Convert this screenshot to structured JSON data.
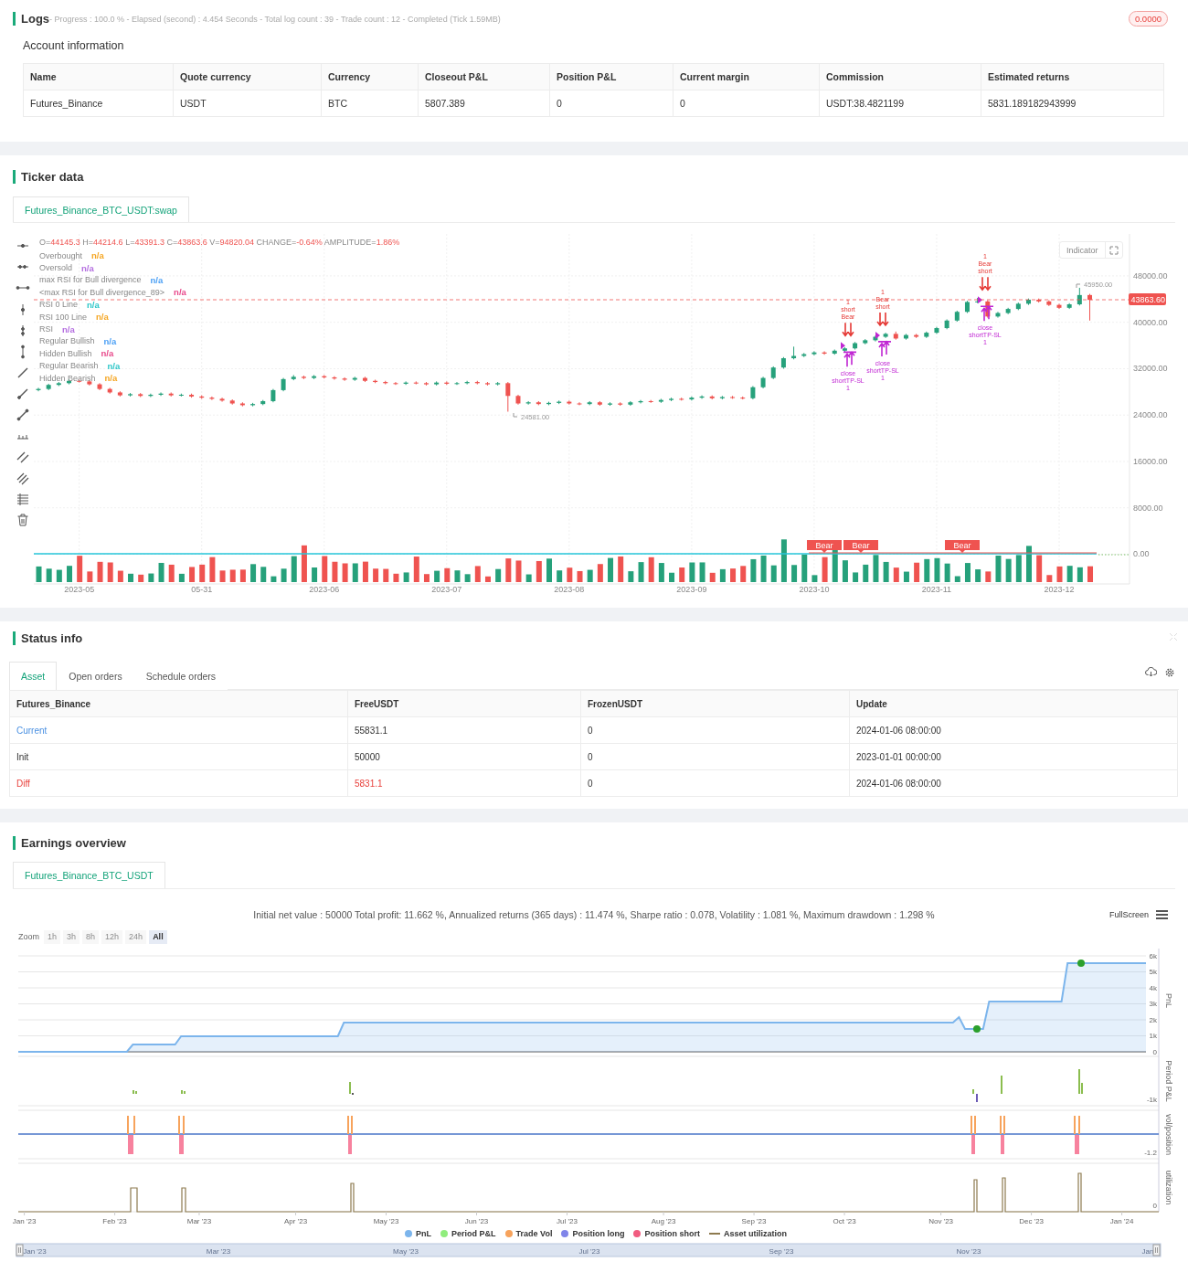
{
  "logs": {
    "title": "Logs",
    "progress": "- Progress : 100.0 % - Elapsed (second) : 4.454  Seconds - Total log count : 39 - Trade count : 12 - Completed (Tick 1.59MB)",
    "badge": "0.0000",
    "account": {
      "title": "Account information",
      "columns": [
        "Name",
        "Quote currency",
        "Currency",
        "Closeout P&L",
        "Position P&L",
        "Current margin",
        "Commission",
        "Estimated returns"
      ],
      "rows": [
        [
          "Futures_Binance",
          "USDT",
          "BTC",
          "5807.389",
          "0",
          "0",
          "USDT:38.4821199",
          "5831.189182943999"
        ]
      ]
    }
  },
  "ticker": {
    "title": "Ticker data",
    "tabs": [
      {
        "label": "Futures_Binance_BTC_USDT:swap",
        "selected": true
      }
    ],
    "ohlc": [
      {
        "label": "O=",
        "value": "44145.3"
      },
      {
        "label": "H=",
        "value": "44214.6"
      },
      {
        "label": "L=",
        "value": "43391.3"
      },
      {
        "label": "C=",
        "value": "43863.6"
      },
      {
        "label": "V=",
        "value": "94820.04"
      },
      {
        "label": "CHANGE=",
        "value": "-0.64%"
      },
      {
        "label": "AMPLITUDE=",
        "value": "1.86%"
      }
    ],
    "indicators": [
      {
        "label": "Overbought",
        "value": "n/a",
        "color": "#f5a623"
      },
      {
        "label": "Oversold",
        "value": "n/a",
        "color": "#b46ee0"
      },
      {
        "label": "max RSI for Bull divergence",
        "value": "n/a",
        "color": "#4a9ff5"
      },
      {
        "label": "<max RSI for Bull divergence_89>",
        "value": "n/a",
        "color": "#e8488a"
      },
      {
        "label": "RSI 0 Line",
        "value": "n/a",
        "color": "#2ec7c9"
      },
      {
        "label": "RSI 100 Line",
        "value": "n/a",
        "color": "#f5a623"
      },
      {
        "label": "RSI",
        "value": "n/a",
        "color": "#b46ee0"
      },
      {
        "label": "Regular Bullish",
        "value": "n/a",
        "color": "#4a9ff5"
      },
      {
        "label": "Hidden Bullish",
        "value": "n/a",
        "color": "#e8488a"
      },
      {
        "label": "Regular Bearish",
        "value": "n/a",
        "color": "#2ec7c9"
      },
      {
        "label": "Hidden Bearish",
        "value": "n/a",
        "color": "#f5a623"
      }
    ],
    "indicator_button": "Indicator",
    "last_price": "43863.60",
    "high_label": "45950.00",
    "low_label": "24581.00",
    "signals": [
      {
        "above": [
          "1",
          "short",
          "Bear"
        ],
        "below": [
          "close",
          "shortTP-SL",
          "1"
        ]
      },
      {
        "above": [
          "1",
          "Bear",
          "short"
        ],
        "below": [
          "close",
          "shortTP-SL",
          "1"
        ]
      },
      {
        "above": [
          "1",
          "Bear",
          "short"
        ],
        "below": [
          "close",
          "shortTP-SL",
          "1"
        ]
      }
    ],
    "volume_labels": [
      "Bear",
      "Bear",
      "Bear"
    ],
    "chart_data": {
      "type": "candlestick",
      "categories": [
        null,
        null,
        null,
        null,
        "2023-05",
        null,
        null,
        null,
        null,
        null,
        null,
        null,
        null,
        null,
        null,
        null,
        "05-31",
        null,
        null,
        null,
        null,
        null,
        null,
        null,
        null,
        null,
        null,
        null,
        "2023-06",
        null,
        null,
        null,
        null,
        null,
        null,
        null,
        null,
        null,
        null,
        null,
        "2023-07",
        null,
        null,
        null,
        null,
        null,
        null,
        null,
        null,
        null,
        null,
        null,
        "2023-08",
        null,
        null,
        null,
        null,
        null,
        null,
        null,
        null,
        null,
        null,
        null,
        "2023-09",
        null,
        null,
        null,
        null,
        null,
        null,
        null,
        null,
        null,
        null,
        null,
        "2023-10",
        null,
        null,
        null,
        null,
        null,
        null,
        null,
        null,
        null,
        null,
        null,
        "2023-11",
        null,
        null,
        null,
        null,
        null,
        null,
        null,
        null,
        null,
        null,
        null,
        "2023-12",
        null,
        null,
        null
      ],
      "ylim": [
        -4970,
        55239
      ],
      "grid": true,
      "yticks": [
        {
          "value": 48000,
          "label": "48000.00"
        },
        {
          "value": 40000,
          "label": "40000.00"
        },
        {
          "value": 32000,
          "label": "32000.00"
        },
        {
          "value": 24000,
          "label": "24000.00"
        },
        {
          "value": 16000,
          "label": "16000.00"
        },
        {
          "value": 8000,
          "label": "8000.00"
        },
        {
          "value": 0,
          "label": "0.00"
        }
      ],
      "ohlc": [
        [
          28300,
          28700,
          28100,
          28500
        ],
        [
          28500,
          29400,
          28300,
          29200
        ],
        [
          29200,
          29700,
          29000,
          29500
        ],
        [
          29500,
          30200,
          29300,
          29900
        ],
        [
          29900,
          30100,
          29600,
          29800
        ],
        [
          29800,
          30000,
          29100,
          29300
        ],
        [
          29300,
          29500,
          28300,
          28500
        ],
        [
          28500,
          28700,
          27700,
          27900
        ],
        [
          27900,
          28100,
          27200,
          27400
        ],
        [
          27400,
          27800,
          27200,
          27600
        ],
        [
          27600,
          27800,
          27100,
          27300
        ],
        [
          27300,
          27700,
          27100,
          27500
        ],
        [
          27500,
          27900,
          27300,
          27700
        ],
        [
          27700,
          27900,
          27200,
          27400
        ],
        [
          27400,
          27700,
          27200,
          27500
        ],
        [
          27500,
          27700,
          27000,
          27200
        ],
        [
          27200,
          27400,
          26800,
          27000
        ],
        [
          27000,
          27200,
          26600,
          26800
        ],
        [
          26800,
          27000,
          26300,
          26500
        ],
        [
          26500,
          26700,
          25800,
          26000
        ],
        [
          26000,
          26200,
          25500,
          25700
        ],
        [
          25700,
          26100,
          25500,
          25900
        ],
        [
          25900,
          26600,
          25700,
          26400
        ],
        [
          26400,
          28500,
          26200,
          28300
        ],
        [
          28300,
          30400,
          28100,
          30200
        ],
        [
          30200,
          30900,
          30000,
          30600
        ],
        [
          30600,
          30800,
          30200,
          30400
        ],
        [
          30400,
          30900,
          30200,
          30700
        ],
        [
          30700,
          30900,
          30300,
          30500
        ],
        [
          30500,
          30700,
          30100,
          30300
        ],
        [
          30300,
          30500,
          29900,
          30100
        ],
        [
          30100,
          30600,
          29900,
          30400
        ],
        [
          30400,
          30600,
          29700,
          29900
        ],
        [
          29900,
          30100,
          29500,
          29700
        ],
        [
          29700,
          29900,
          29300,
          29500
        ],
        [
          29500,
          29700,
          29200,
          29400
        ],
        [
          29400,
          29800,
          29200,
          29600
        ],
        [
          29600,
          29800,
          29300,
          29500
        ],
        [
          29500,
          29700,
          29100,
          29300
        ],
        [
          29300,
          29800,
          29100,
          29600
        ],
        [
          29600,
          29800,
          29200,
          29400
        ],
        [
          29400,
          29700,
          29200,
          29500
        ],
        [
          29500,
          29900,
          29300,
          29700
        ],
        [
          29700,
          29900,
          29300,
          29500
        ],
        [
          29500,
          29700,
          29100,
          29300
        ],
        [
          29300,
          29700,
          29100,
          29500
        ],
        [
          29500,
          29700,
          24581,
          27300
        ],
        [
          27300,
          27500,
          25800,
          26000
        ],
        [
          26000,
          26400,
          25800,
          26200
        ],
        [
          26200,
          26400,
          25700,
          25900
        ],
        [
          25900,
          26300,
          25700,
          26100
        ],
        [
          26100,
          26500,
          25900,
          26300
        ],
        [
          26300,
          26500,
          25800,
          26000
        ],
        [
          26000,
          26200,
          25700,
          25900
        ],
        [
          25900,
          26400,
          25700,
          26200
        ],
        [
          26200,
          26400,
          25600,
          25800
        ],
        [
          25800,
          26200,
          25600,
          26000
        ],
        [
          26000,
          26200,
          25600,
          25800
        ],
        [
          25800,
          26400,
          25600,
          26200
        ],
        [
          26200,
          26600,
          26000,
          26400
        ],
        [
          26400,
          26600,
          26100,
          26300
        ],
        [
          26300,
          26800,
          26100,
          26600
        ],
        [
          26600,
          27000,
          26400,
          26800
        ],
        [
          26800,
          27000,
          26500,
          26700
        ],
        [
          26700,
          27200,
          26500,
          27000
        ],
        [
          27000,
          27400,
          26800,
          27200
        ],
        [
          27200,
          27400,
          26700,
          26900
        ],
        [
          26900,
          27300,
          26700,
          27100
        ],
        [
          27100,
          27300,
          26800,
          27000
        ],
        [
          27000,
          27200,
          26700,
          26900
        ],
        [
          26900,
          29000,
          26700,
          28800
        ],
        [
          28800,
          30600,
          28600,
          30400
        ],
        [
          30400,
          32400,
          30200,
          32200
        ],
        [
          32200,
          34000,
          32000,
          33800
        ],
        [
          33800,
          35800,
          33600,
          34200
        ],
        [
          34200,
          34700,
          34000,
          34500
        ],
        [
          34500,
          35000,
          34300,
          34800
        ],
        [
          34800,
          35000,
          34400,
          34600
        ],
        [
          34600,
          35300,
          34400,
          35100
        ],
        [
          35100,
          35700,
          34900,
          35500
        ],
        [
          35500,
          36600,
          35300,
          36400
        ],
        [
          36400,
          37100,
          36200,
          36900
        ],
        [
          36900,
          37700,
          36700,
          37500
        ],
        [
          37500,
          38200,
          37300,
          38000
        ],
        [
          38000,
          38400,
          37000,
          37200
        ],
        [
          37200,
          38000,
          37000,
          37800
        ],
        [
          37800,
          38000,
          37300,
          37500
        ],
        [
          37500,
          38400,
          37300,
          38200
        ],
        [
          38200,
          39200,
          38000,
          39000
        ],
        [
          39000,
          40500,
          38800,
          40300
        ],
        [
          40300,
          42000,
          40100,
          41800
        ],
        [
          41800,
          43700,
          41600,
          43500
        ],
        [
          43500,
          44200,
          43300,
          43600
        ],
        [
          43600,
          43800,
          40800,
          41000
        ],
        [
          41000,
          41800,
          40800,
          41600
        ],
        [
          41600,
          42500,
          41400,
          42300
        ],
        [
          42300,
          43400,
          42100,
          43200
        ],
        [
          43200,
          44100,
          43000,
          43900
        ],
        [
          43900,
          44100,
          43400,
          43600
        ],
        [
          43600,
          43800,
          42800,
          43000
        ],
        [
          43000,
          43200,
          42300,
          42500
        ],
        [
          42500,
          43300,
          42300,
          43100
        ],
        [
          43100,
          45950,
          42900,
          44700
        ],
        [
          44700,
          44900,
          40300,
          43863
        ]
      ]
    }
  },
  "status": {
    "title": "Status info",
    "tabs": [
      {
        "label": "Asset",
        "selected": true
      },
      {
        "label": "Open orders",
        "selected": false
      },
      {
        "label": "Schedule orders",
        "selected": false
      }
    ],
    "columns": [
      "Futures_Binance",
      "FreeUSDT",
      "FrozenUSDT",
      "Update"
    ],
    "rows": [
      {
        "cells": [
          {
            "text": "Current",
            "color": "#4a90e2"
          },
          {
            "text": "55831.1"
          },
          {
            "text": "0"
          },
          {
            "text": "2024-01-06 08:00:00"
          }
        ]
      },
      {
        "cells": [
          {
            "text": "Init"
          },
          {
            "text": "50000"
          },
          {
            "text": "0"
          },
          {
            "text": "2023-01-01 00:00:00"
          }
        ]
      },
      {
        "cells": [
          {
            "text": "Diff",
            "color": "#e8413c"
          },
          {
            "text": "5831.1",
            "color": "#e8413c"
          },
          {
            "text": "0"
          },
          {
            "text": "2024-01-06 08:00:00"
          }
        ]
      }
    ]
  },
  "earnings": {
    "title": "Earnings overview",
    "tabs": [
      {
        "label": "Futures_Binance_BTC_USDT",
        "selected": true
      }
    ],
    "summary": "Initial net value : 50000 Total profit: 11.662 %, Annualized returns (365 days) : 11.474 %, Sharpe ratio : 0.078, Volatility : 1.081 %, Maximum drawdown : 1.298 %",
    "fullscreen": "FullScreen",
    "zoom_label": "Zoom",
    "zoom": [
      {
        "label": "1h",
        "selected": false
      },
      {
        "label": "3h",
        "selected": false
      },
      {
        "label": "8h",
        "selected": false
      },
      {
        "label": "12h",
        "selected": false
      },
      {
        "label": "24h",
        "selected": false
      },
      {
        "label": "All",
        "selected": true
      }
    ],
    "chart_data": {
      "type": "area",
      "ylabel": "PnL",
      "grid": true,
      "categories": [
        null,
        null,
        null,
        null,
        null,
        null,
        null,
        null,
        null,
        null,
        null,
        null,
        null,
        null,
        null,
        null,
        null,
        null,
        null,
        null,
        null,
        null,
        null,
        null,
        null,
        null,
        null,
        null,
        null,
        null,
        null,
        null,
        null,
        null,
        null,
        null,
        null,
        null,
        null,
        null,
        null,
        null,
        null,
        null,
        null,
        null,
        null,
        null,
        null,
        null,
        null,
        null,
        null,
        null,
        null,
        null,
        null,
        null,
        null,
        null,
        null,
        null,
        null,
        null,
        null,
        null,
        null,
        null,
        null,
        null,
        null,
        null,
        null,
        null,
        null,
        null,
        null,
        null,
        null,
        null,
        null,
        null,
        null,
        null,
        null,
        null,
        null,
        null,
        null,
        null,
        null,
        null,
        null,
        null,
        null,
        null,
        null,
        null,
        null,
        null,
        null,
        null,
        null,
        null,
        null,
        null,
        null,
        null,
        null,
        null,
        null,
        null,
        null,
        null,
        null,
        null,
        null,
        null,
        null,
        null,
        null,
        null,
        null,
        null,
        null,
        null,
        null,
        null,
        null,
        null,
        null,
        null,
        null,
        null,
        null,
        null,
        null,
        null,
        null,
        null,
        null,
        null,
        null,
        null,
        null,
        null,
        null,
        null,
        null,
        null,
        null,
        null,
        null,
        null,
        null,
        null,
        null,
        null,
        null,
        null,
        null,
        null,
        null,
        null,
        null,
        null,
        null,
        null,
        null,
        null,
        null,
        null,
        null,
        null,
        null,
        null,
        null,
        null,
        null,
        null,
        null,
        null,
        null,
        null,
        null,
        null,
        null,
        null
      ],
      "series": [
        {
          "name": "PnL",
          "color": "#7cb5ec",
          "values": [
            0,
            0,
            0,
            0,
            0,
            0,
            0,
            0,
            0,
            0,
            0,
            0,
            0,
            0,
            0,
            0,
            0,
            0,
            0,
            460,
            460,
            460,
            460,
            460,
            460,
            460,
            460,
            970,
            970,
            970,
            970,
            970,
            970,
            970,
            970,
            970,
            970,
            970,
            970,
            970,
            970,
            970,
            970,
            970,
            970,
            970,
            970,
            970,
            970,
            970,
            970,
            970,
            970,
            970,
            1830,
            1830,
            1830,
            1830,
            1830,
            1830,
            1830,
            1830,
            1830,
            1830,
            1830,
            1830,
            1830,
            1830,
            1830,
            1830,
            1830,
            1830,
            1830,
            1830,
            1830,
            1830,
            1830,
            1830,
            1830,
            1830,
            1830,
            1830,
            1830,
            1830,
            1830,
            1830,
            1830,
            1830,
            1830,
            1830,
            1830,
            1830,
            1830,
            1830,
            1830,
            1830,
            1830,
            1830,
            1830,
            1830,
            1830,
            1830,
            1830,
            1830,
            1830,
            1830,
            1830,
            1830,
            1830,
            1830,
            1830,
            1830,
            1830,
            1830,
            1830,
            1830,
            1830,
            1830,
            1830,
            1830,
            1830,
            1830,
            1830,
            1830,
            1830,
            1830,
            1830,
            1830,
            1830,
            1830,
            1830,
            1830,
            1830,
            1830,
            1830,
            1830,
            1830,
            1830,
            1830,
            1830,
            1830,
            1830,
            1830,
            1830,
            1830,
            1830,
            1830,
            1830,
            1830,
            1830,
            1830,
            1830,
            1830,
            1830,
            1830,
            1830,
            2170,
            1430,
            1430,
            1430,
            1430,
            3140,
            3140,
            3140,
            3140,
            3140,
            3140,
            3140,
            3140,
            3140,
            3140,
            3140,
            3140,
            3140,
            5540,
            5540,
            5540,
            5540,
            5540,
            5540,
            5540,
            5540,
            5540,
            5540,
            5540,
            5540,
            5540,
            5540
          ]
        }
      ],
      "ylim": [
        0,
        6000
      ],
      "yticks": [
        {
          "value": 0,
          "label": "0"
        },
        {
          "value": 1000,
          "label": "1k"
        },
        {
          "value": 2000,
          "label": "2k"
        },
        {
          "value": 3000,
          "label": "3k"
        },
        {
          "value": 4000,
          "label": "4k"
        },
        {
          "value": 5000,
          "label": "5k"
        },
        {
          "value": 6000,
          "label": "6k"
        }
      ]
    },
    "x_axis_labels": [
      "Jan '23",
      "Feb '23",
      "Mar '23",
      "Apr '23",
      "May '23",
      "Jun '23",
      "Jul '23",
      "Aug '23",
      "Sep '23",
      "Oct '23",
      "Nov '23",
      "Dec '23",
      "Jan '24"
    ],
    "panes": [
      {
        "title": "Period P&L",
        "tick": "-1k"
      },
      {
        "title": "vol/position",
        "tick": "-1.2"
      },
      {
        "title": "utilization",
        "tick": "0"
      }
    ],
    "legend": [
      {
        "label": "Period P&L",
        "color": "#90ed7d",
        "kind": "dot"
      },
      {
        "label": "Trade Vol",
        "color": "#f7a35c",
        "kind": "dot"
      },
      {
        "label": "Position long",
        "color": "#8085e9",
        "kind": "dot"
      },
      {
        "label": "Position short",
        "color": "#f15c80",
        "kind": "dot"
      },
      {
        "label": "Asset utilization",
        "color": "#8d7a4f",
        "kind": "line"
      }
    ],
    "navigator": [
      "Jan '23",
      "Mar '23",
      "May '23",
      "Jul '23",
      "Sep '23",
      "Nov '23",
      "Jan"
    ]
  }
}
